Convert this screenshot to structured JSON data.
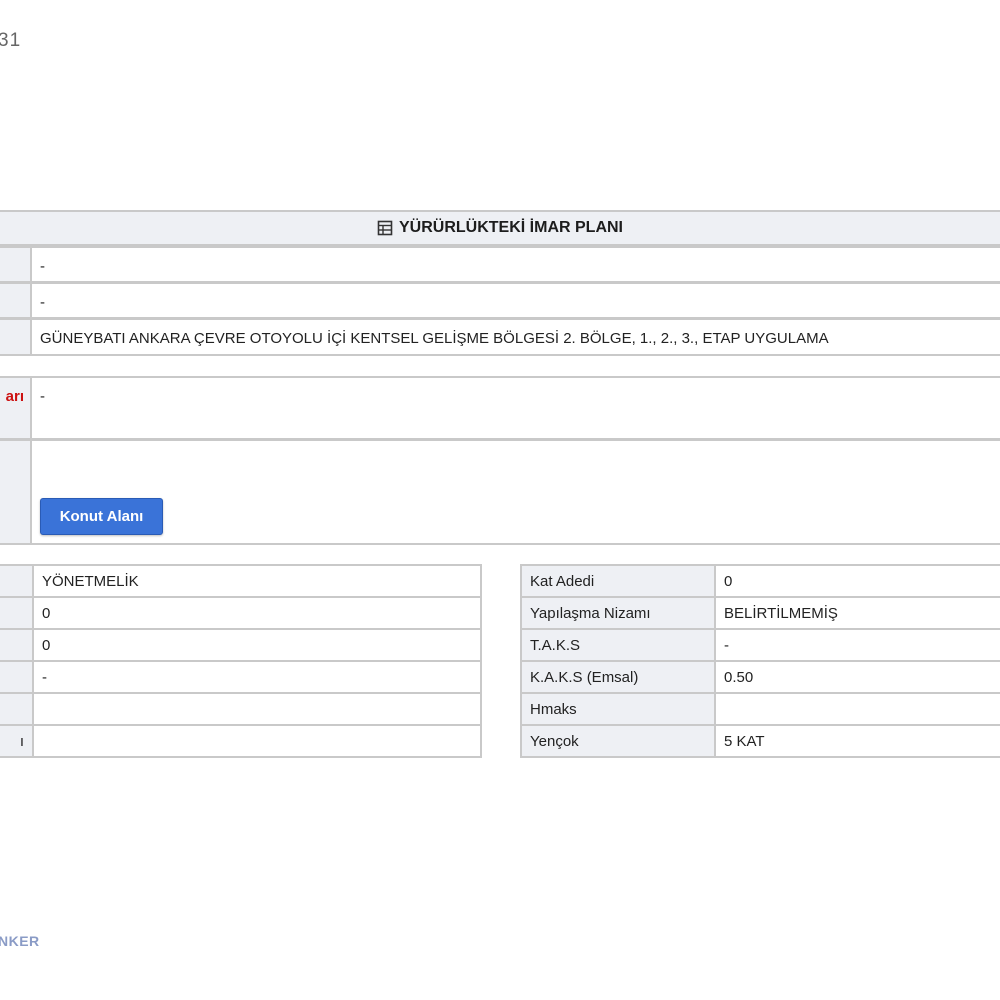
{
  "page": {
    "corner_text": "31",
    "footer_text": "NKER"
  },
  "plan": {
    "title": "YÜRÜRLÜKTEKİ İMAR PLANI",
    "title_icon": "table-icon",
    "rows": [
      {
        "label": "",
        "value": "-"
      },
      {
        "label": "",
        "value": "-"
      },
      {
        "label": "",
        "value": "GÜNEYBATI ANKARA ÇEVRE OTOYOLU İÇİ KENTSEL GELİŞME BÖLGESİ 2. BÖLGE, 1., 2., 3., ETAP UYGULAMA"
      }
    ],
    "area_label": "arı",
    "area_value": "-",
    "label_color": "#cc1111",
    "button_label": "Konut Alanı",
    "button_color": "#3a73d8"
  },
  "left_attrs": [
    {
      "key": "",
      "value": "YÖNETMELİK"
    },
    {
      "key": "",
      "value": "0"
    },
    {
      "key": "",
      "value": "0"
    },
    {
      "key": "",
      "value": "-"
    },
    {
      "key": "",
      "value": ""
    },
    {
      "key": "ı",
      "value": ""
    }
  ],
  "right_attrs": [
    {
      "key": "Kat Adedi",
      "value": "0"
    },
    {
      "key": "Yapılaşma Nizamı",
      "value": "BELİRTİLMEMİŞ"
    },
    {
      "key": "T.A.K.S",
      "value": "-"
    },
    {
      "key": "K.A.K.S (Emsal)",
      "value": "0.50"
    },
    {
      "key": "Hmaks",
      "value": ""
    },
    {
      "key": "Yençok",
      "value": "5 KAT"
    }
  ]
}
